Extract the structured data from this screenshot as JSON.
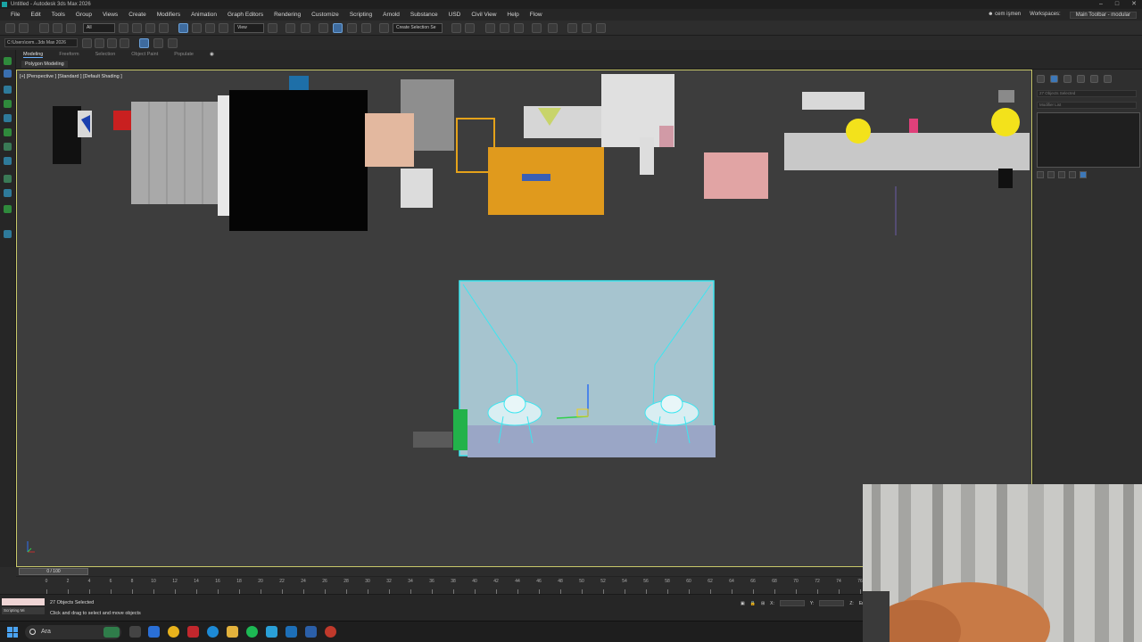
{
  "window": {
    "title": "Untitled - Autodesk 3ds Max 2026",
    "controls": [
      "–",
      "□",
      "✕"
    ]
  },
  "menu": {
    "items": [
      "File",
      "Edit",
      "Tools",
      "Group",
      "Views",
      "Create",
      "Modifiers",
      "Animation",
      "Graph Editors",
      "Rendering",
      "Customize",
      "Scripting",
      "Arnold",
      "Substance",
      "USD",
      "Civil View",
      "Help",
      "Flow"
    ],
    "user": "cem işmen",
    "workspaces_label": "Workspaces:",
    "workspace_value": "Main Toolbar - modular"
  },
  "toolbar": {
    "selection_filter": "All",
    "reference_coord": "View",
    "named_selection_placeholder": "Create Selection Se"
  },
  "toolbar2": {
    "project_path": "C:\\Users\\cem...3ds Max 2026"
  },
  "ribbon": {
    "tabs": [
      "Modeling",
      "Freeform",
      "Selection",
      "Object Paint",
      "Populate"
    ],
    "active_tab": "Modeling",
    "sub_label": "Polygon Modeling"
  },
  "viewport": {
    "label": "[+] [Perspective ] [Standard ] [Default Shading ]"
  },
  "command_panel": {
    "selection_field": "27 Objects Selected",
    "modifier_list": "Modifier List"
  },
  "timeline": {
    "frame_display": "0 / 100",
    "ticks": [
      "0",
      "2",
      "4",
      "6",
      "8",
      "10",
      "12",
      "14",
      "16",
      "18",
      "20",
      "22",
      "24",
      "26",
      "28",
      "30",
      "32",
      "34",
      "36",
      "38",
      "40",
      "42",
      "44",
      "46",
      "48",
      "50",
      "52",
      "54",
      "56",
      "58",
      "60",
      "62",
      "64",
      "66",
      "68",
      "70",
      "72",
      "74",
      "76"
    ]
  },
  "status": {
    "selection": "27 Objects Selected",
    "prompt": "Click and drag to select and move objects",
    "listener": "Scripting Mi",
    "x_label": "X:",
    "y_label": "Y:",
    "z_label": "Z:",
    "enabled_label": "Enabled:"
  },
  "taskbar": {
    "search_placeholder": "Ara"
  }
}
